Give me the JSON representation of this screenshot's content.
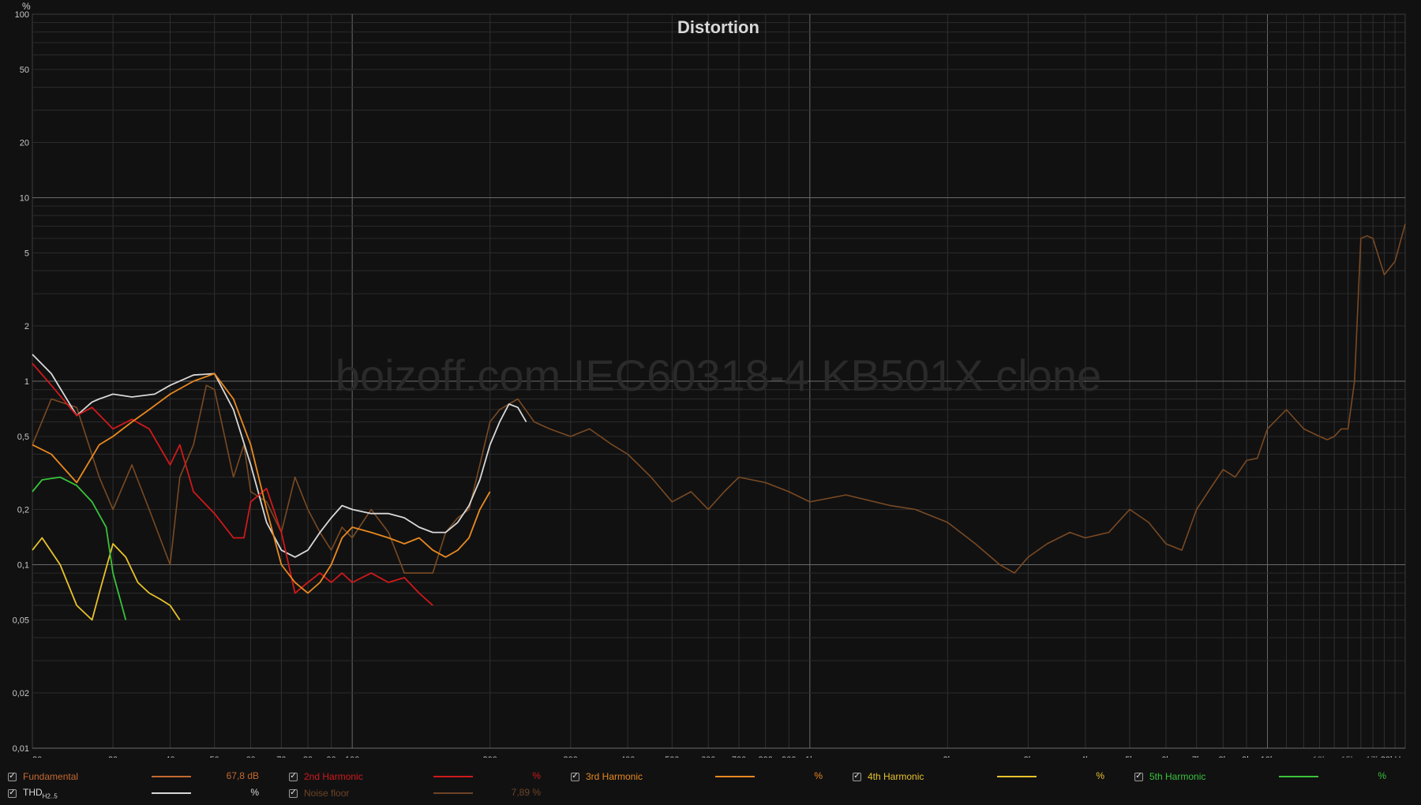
{
  "chart_data": {
    "type": "line",
    "title": "Distortion",
    "watermark": "boizoff.com IEC60318-4 KB501X clone",
    "y_unit": "%",
    "y_scale": "log",
    "x_scale": "log",
    "xlim": [
      20,
      20000
    ],
    "ylim": [
      0.01,
      100
    ],
    "grid": true,
    "y_ticks": [
      "100",
      "50",
      "20",
      "10",
      "5",
      "2",
      "1",
      "0,5",
      "0,2",
      "0,1",
      "0,05",
      "0,02",
      "0,01"
    ],
    "y_tick_values": [
      100,
      50,
      20,
      10,
      5,
      2,
      1,
      0.5,
      0.2,
      0.1,
      0.05,
      0.02,
      0.01
    ],
    "x_ticks": [
      "20",
      "30",
      "40",
      "50",
      "60",
      "70",
      "80",
      "90",
      "100",
      "200",
      "300",
      "400",
      "500",
      "600",
      "700",
      "800",
      "900",
      "1k",
      "2k",
      "3k",
      "4k",
      "5k",
      "6k",
      "7k",
      "8k",
      "9k",
      "10k",
      "13k",
      "15k",
      "17k",
      "20kHz"
    ],
    "x_tick_values": [
      20,
      30,
      40,
      50,
      60,
      70,
      80,
      90,
      100,
      200,
      300,
      400,
      500,
      600,
      700,
      800,
      900,
      1000,
      2000,
      3000,
      4000,
      5000,
      6000,
      7000,
      8000,
      9000,
      10000,
      13000,
      15000,
      17000,
      20000
    ],
    "series": [
      {
        "name": "Noise floor",
        "color": "#7a4a22",
        "x": [
          20,
          22,
          25,
          28,
          30,
          33,
          36,
          40,
          42,
          45,
          48,
          50,
          55,
          58,
          60,
          65,
          70,
          75,
          80,
          85,
          90,
          95,
          100,
          110,
          120,
          130,
          140,
          150,
          160,
          170,
          180,
          190,
          200,
          210,
          220,
          230,
          250,
          270,
          300,
          330,
          370,
          400,
          450,
          500,
          550,
          600,
          650,
          700,
          800,
          900,
          1000,
          1200,
          1500,
          1700,
          2000,
          2300,
          2600,
          2800,
          3000,
          3300,
          3700,
          4000,
          4500,
          5000,
          5500,
          6000,
          6500,
          7000,
          7500,
          8000,
          8500,
          9000,
          9500,
          10000,
          11000,
          12000,
          13000,
          13500,
          14000,
          14500,
          15000,
          15500,
          16000,
          16500,
          17000,
          18000,
          19000,
          20000
        ],
        "y": [
          0.45,
          0.8,
          0.72,
          0.3,
          0.2,
          0.35,
          0.2,
          0.1,
          0.3,
          0.45,
          0.95,
          0.9,
          0.3,
          0.45,
          0.25,
          0.22,
          0.15,
          0.3,
          0.2,
          0.15,
          0.12,
          0.16,
          0.14,
          0.2,
          0.15,
          0.09,
          0.09,
          0.09,
          0.15,
          0.18,
          0.2,
          0.35,
          0.6,
          0.7,
          0.75,
          0.8,
          0.6,
          0.55,
          0.5,
          0.55,
          0.45,
          0.4,
          0.3,
          0.22,
          0.25,
          0.2,
          0.25,
          0.3,
          0.28,
          0.25,
          0.22,
          0.24,
          0.21,
          0.2,
          0.17,
          0.13,
          0.1,
          0.09,
          0.11,
          0.13,
          0.15,
          0.14,
          0.15,
          0.2,
          0.17,
          0.13,
          0.12,
          0.2,
          0.26,
          0.33,
          0.3,
          0.37,
          0.38,
          0.55,
          0.7,
          0.55,
          0.5,
          0.48,
          0.5,
          0.55,
          0.55,
          1.0,
          6.0,
          6.2,
          6.0,
          3.8,
          4.5,
          7.2
        ]
      },
      {
        "name": "THD H2..5",
        "color": "#d8d8d8",
        "x": [
          20,
          22,
          25,
          27,
          28,
          30,
          33,
          37,
          40,
          45,
          50,
          55,
          60,
          65,
          70,
          75,
          80,
          85,
          90,
          95,
          100,
          110,
          120,
          130,
          140,
          150,
          160,
          170,
          180,
          190,
          200,
          210,
          220,
          230,
          240
        ],
        "y": [
          1.4,
          1.1,
          0.65,
          0.77,
          0.8,
          0.85,
          0.82,
          0.85,
          0.95,
          1.08,
          1.1,
          0.7,
          0.35,
          0.17,
          0.12,
          0.11,
          0.12,
          0.15,
          0.18,
          0.21,
          0.2,
          0.19,
          0.19,
          0.18,
          0.16,
          0.15,
          0.15,
          0.17,
          0.21,
          0.29,
          0.45,
          0.6,
          0.75,
          0.72,
          0.6
        ]
      },
      {
        "name": "2nd Harmonic",
        "color": "#d0191a",
        "x": [
          20,
          22,
          25,
          27,
          30,
          33,
          36,
          40,
          42,
          45,
          50,
          55,
          58,
          60,
          65,
          70,
          75,
          80,
          85,
          90,
          95,
          100,
          110,
          120,
          130,
          140,
          150
        ],
        "y": [
          1.25,
          0.95,
          0.65,
          0.72,
          0.55,
          0.62,
          0.55,
          0.35,
          0.45,
          0.25,
          0.19,
          0.14,
          0.14,
          0.22,
          0.26,
          0.15,
          0.07,
          0.08,
          0.09,
          0.08,
          0.09,
          0.08,
          0.09,
          0.08,
          0.085,
          0.07,
          0.06
        ]
      },
      {
        "name": "3rd Harmonic",
        "color": "#e8891f",
        "x": [
          20,
          22,
          25,
          28,
          30,
          33,
          36,
          40,
          45,
          50,
          55,
          60,
          65,
          70,
          75,
          80,
          85,
          90,
          95,
          100,
          110,
          120,
          130,
          140,
          150,
          160,
          170,
          180,
          190,
          200
        ],
        "y": [
          0.45,
          0.4,
          0.28,
          0.45,
          0.5,
          0.6,
          0.7,
          0.85,
          1.0,
          1.1,
          0.8,
          0.45,
          0.2,
          0.1,
          0.08,
          0.07,
          0.08,
          0.1,
          0.14,
          0.16,
          0.15,
          0.14,
          0.13,
          0.14,
          0.12,
          0.11,
          0.12,
          0.14,
          0.2,
          0.25
        ]
      },
      {
        "name": "4th Harmonic",
        "color": "#e8c22a",
        "x": [
          20,
          21,
          23,
          25,
          27,
          28,
          30,
          32,
          34,
          36,
          38,
          40,
          42
        ],
        "y": [
          0.12,
          0.14,
          0.1,
          0.06,
          0.05,
          0.07,
          0.13,
          0.11,
          0.08,
          0.07,
          0.065,
          0.06,
          0.05
        ]
      },
      {
        "name": "5th Harmonic",
        "color": "#39c23a",
        "x": [
          20,
          21,
          23,
          25,
          27,
          29,
          30,
          32
        ],
        "y": [
          0.25,
          0.29,
          0.3,
          0.27,
          0.22,
          0.16,
          0.09,
          0.05
        ]
      }
    ]
  },
  "legend": {
    "fundamental": {
      "label": "Fundamental",
      "value": "67,8 dB",
      "color": "#c4692f"
    },
    "h2": {
      "label": "2nd Harmonic",
      "value": "%",
      "color": "#d0191a"
    },
    "h3": {
      "label": "3rd Harmonic",
      "value": "%",
      "color": "#e8891f"
    },
    "h4": {
      "label": "4th Harmonic",
      "value": "%",
      "color": "#e8c22a"
    },
    "h5": {
      "label": "5th Harmonic",
      "value": "%",
      "color": "#39c23a"
    },
    "thd": {
      "label": "THD",
      "sub": "H2..5",
      "value": "%",
      "color": "#d8d8d8"
    },
    "noise": {
      "label": "Noise floor",
      "value": "7,89 %",
      "color": "#6e4426"
    },
    "check_glyph": "✓"
  }
}
